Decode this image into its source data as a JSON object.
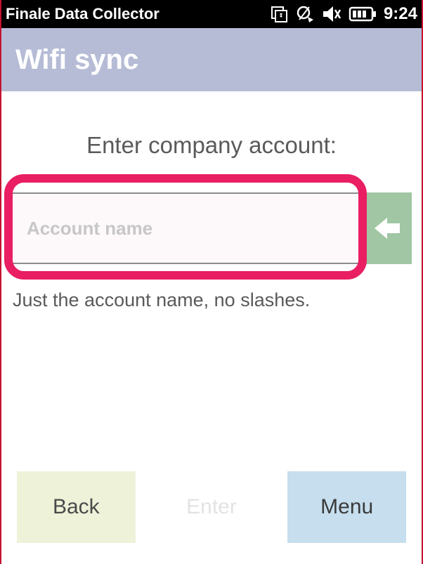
{
  "status_bar": {
    "title": "Finale Data Collector",
    "clock": "9:24"
  },
  "app_bar": {
    "title": "Wifi sync"
  },
  "main": {
    "prompt": "Enter company account:",
    "input_placeholder": "Account name",
    "hint": "Just the account name, no slashes."
  },
  "buttons": {
    "back": "Back",
    "enter": "Enter",
    "menu": "Menu"
  }
}
